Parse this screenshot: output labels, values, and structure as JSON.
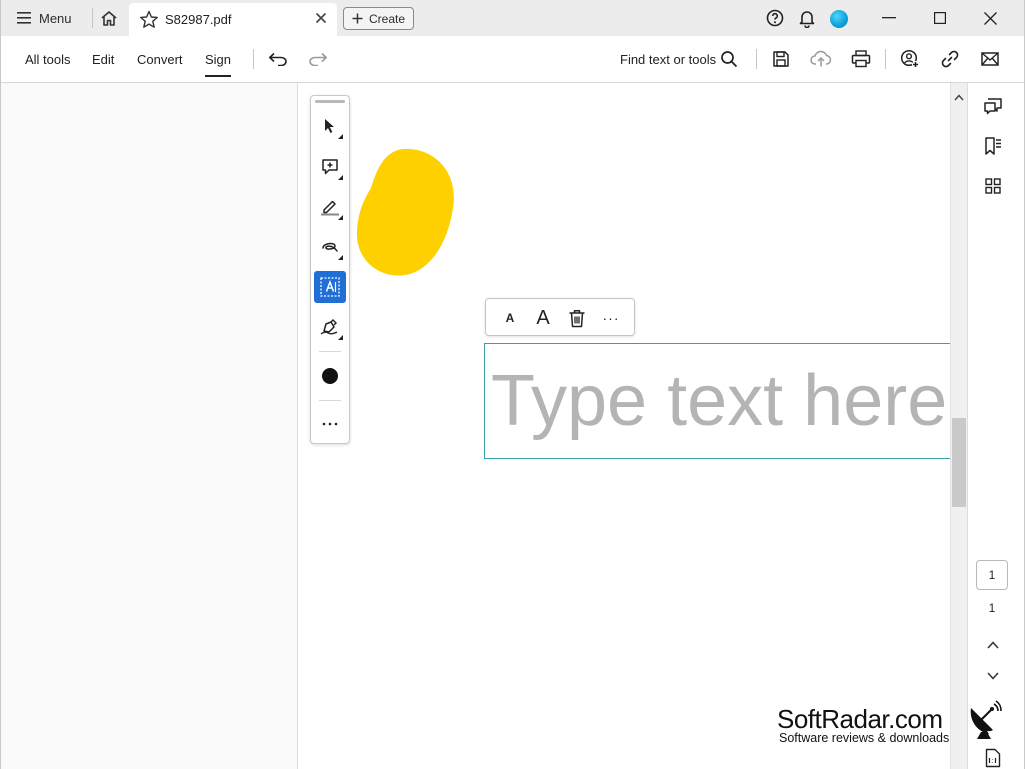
{
  "tabbar": {
    "menu_label": "Menu",
    "doc_tab_name": "S82987.pdf",
    "create_label": "Create"
  },
  "toolbar": {
    "all_tools": "All tools",
    "edit": "Edit",
    "convert": "Convert",
    "sign": "Sign",
    "active_tab": "Sign",
    "find_label": "Find text or tools"
  },
  "vertical_tools": [
    {
      "icon": "select-arrow-icon"
    },
    {
      "icon": "add-comment-icon"
    },
    {
      "icon": "highlight-pen-icon"
    },
    {
      "icon": "freehand-draw-icon"
    },
    {
      "icon": "add-text-icon",
      "selected": true
    },
    {
      "icon": "sign-pen-icon"
    },
    {
      "icon": "color-dot-icon"
    },
    {
      "icon": "more-icon"
    }
  ],
  "annotation": {
    "blob_color": "#FFD000"
  },
  "format_popup": {
    "small_a": "A",
    "large_a": "A",
    "more": "···"
  },
  "textbox": {
    "placeholder": "Type text here"
  },
  "right_rail": {
    "current_page": "1",
    "total_pages": "1"
  },
  "watermark": {
    "brand": "SoftRadar.com",
    "tagline": "Software reviews & downloads"
  },
  "colors": {
    "accent": "#1F6FD6",
    "textbox_border": "#3AA0A8",
    "placeholder_text": "#B4B4B4"
  }
}
